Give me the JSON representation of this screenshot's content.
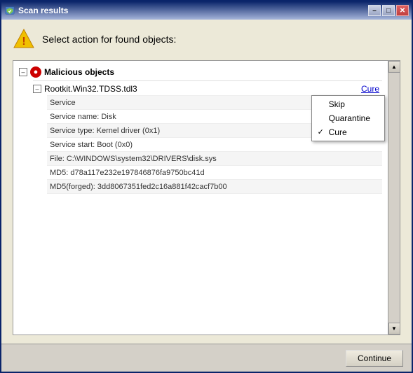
{
  "window": {
    "title": "Scan results",
    "title_icon": "shield-scan-icon"
  },
  "title_buttons": {
    "minimize": "–",
    "maximize": "□",
    "close": "✕"
  },
  "header": {
    "icon": "warning-icon",
    "title": "Select action for found objects:"
  },
  "sections": [
    {
      "id": "malicious",
      "label": "Malicious objects",
      "collapsed": false,
      "items": [
        {
          "name": "Rootkit.Win32.TDSS.tdl3",
          "action_link": "Cure",
          "properties": [
            {
              "label": "Service"
            },
            {
              "label": "Service name: Disk"
            },
            {
              "label": "Service type: Kernel driver (0x1)"
            },
            {
              "label": "Service start: Boot (0x0)"
            },
            {
              "label": "File: C:\\WINDOWS\\system32\\DRIVERS\\disk.sys"
            },
            {
              "label": "MD5: d78a117e232e197846876fa9750bc41d"
            },
            {
              "label": "MD5(forged): 3dd8067351fed2c16a881f42cacf7b00"
            }
          ]
        }
      ]
    }
  ],
  "context_menu": {
    "items": [
      {
        "label": "Skip",
        "checked": false
      },
      {
        "label": "Quarantine",
        "checked": false
      },
      {
        "label": "Cure",
        "checked": true
      }
    ]
  },
  "footer": {
    "continue_label": "Continue"
  }
}
